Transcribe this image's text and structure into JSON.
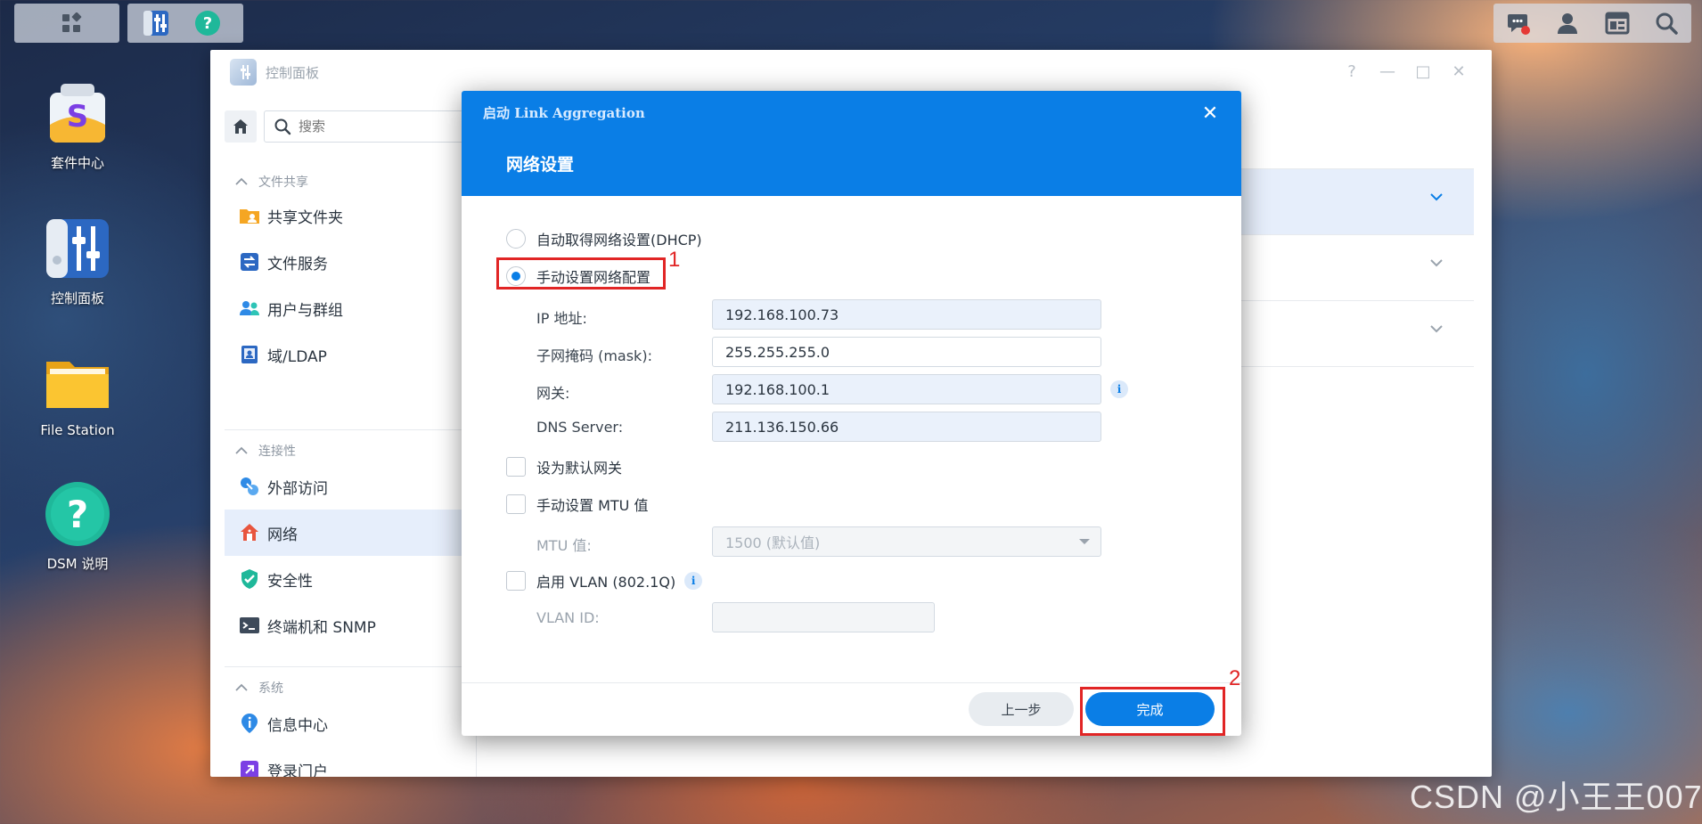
{
  "taskbar": {
    "left_icons": [
      "main-menu-icon"
    ],
    "apps": [
      "control-panel-icon",
      "dsm-help-icon"
    ],
    "right_icons": [
      "notifications-icon",
      "user-icon",
      "widgets-icon",
      "search-icon"
    ]
  },
  "desktop": {
    "icons": [
      {
        "label": "套件中心",
        "icon": "package-center-icon"
      },
      {
        "label": "控制面板",
        "icon": "control-panel-icon"
      },
      {
        "label": "File Station",
        "icon": "file-station-icon"
      },
      {
        "label": "DSM 说明",
        "icon": "dsm-help-icon"
      }
    ]
  },
  "window": {
    "title": "控制面板",
    "controls": [
      "?",
      "—",
      "□",
      "✕"
    ],
    "search_placeholder": "搜索",
    "sections": [
      {
        "title": "文件共享",
        "items": [
          "共享文件夹",
          "文件服务",
          "用户与群组",
          "域/LDAP"
        ]
      },
      {
        "title": "连接性",
        "items": [
          "外部访问",
          "网络",
          "安全性",
          "终端机和 SNMP"
        ]
      },
      {
        "title": "系统",
        "items": [
          "信息中心",
          "登录门户"
        ]
      }
    ],
    "active_item": "网络"
  },
  "dialog": {
    "caption": "启动 Link Aggregation",
    "close": "✕",
    "title": "网络设置",
    "dhcp_label": "自动取得网络设置(DHCP)",
    "manual_label": "手动设置网络配置",
    "ip_label": "IP 地址:",
    "ip_value": "192.168.100.73",
    "mask_label": "子网掩码 (mask):",
    "mask_value": "255.255.255.0",
    "gateway_label": "网关:",
    "gateway_value": "192.168.100.1",
    "dns_label": "DNS Server:",
    "dns_value": "211.136.150.66",
    "default_gw_label": "设为默认网关",
    "mtu_manual_label": "手动设置 MTU 值",
    "mtu_label": "MTU 值:",
    "mtu_value": "1500 (默认值)",
    "vlan_label": "启用 VLAN (802.1Q)",
    "vlan_id_label": "VLAN ID:",
    "vlan_id_value": "",
    "info_glyph": "i",
    "prev_button": "上一步",
    "done_button": "完成"
  },
  "annotations": {
    "one": "1",
    "two": "2"
  },
  "watermark": "CSDN @小王王007",
  "colors": {
    "accent": "#0a7ee6",
    "annotation": "#e12525"
  }
}
